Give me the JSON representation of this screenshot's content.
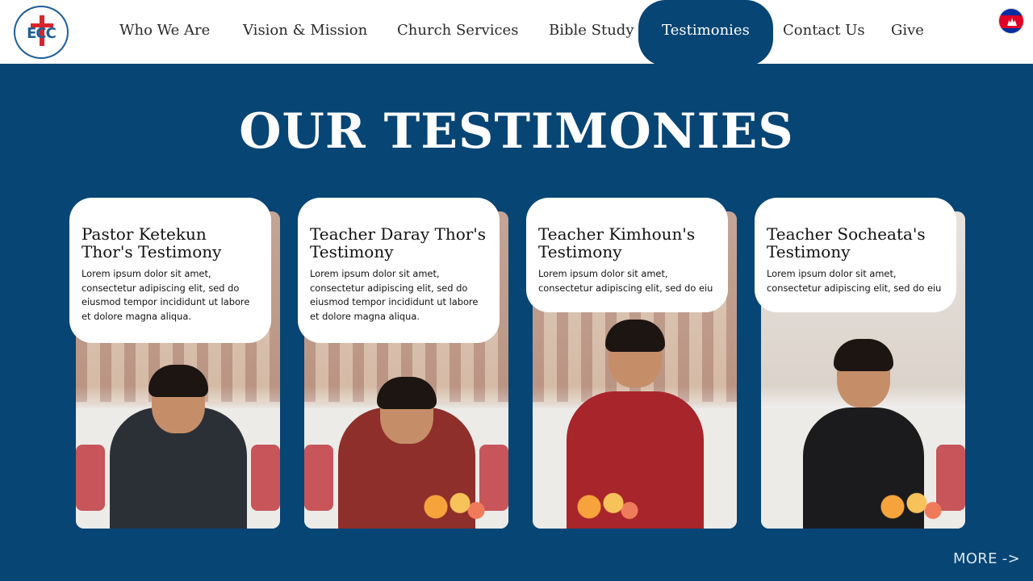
{
  "header": {
    "logo_text": "ECC",
    "nav": [
      {
        "label": "Who We Are"
      },
      {
        "label": "Vision & Mission"
      },
      {
        "label": "Church Services"
      },
      {
        "label": "Bible Study"
      },
      {
        "label": "Testimonies",
        "active": true
      },
      {
        "label": "Contact Us"
      },
      {
        "label": "Give"
      }
    ],
    "language_icon": "cambodia-flag-icon"
  },
  "main": {
    "title": "OUR TESTIMONIES",
    "cards": [
      {
        "title": "Pastor Ketekun Thor's Testimony",
        "text": "Lorem ipsum dolor sit amet, consectetur adipiscing elit, sed do eiusmod tempor incididunt ut labore et dolore magna aliqua."
      },
      {
        "title": "Teacher Daray Thor's Testimony",
        "text": "Lorem ipsum dolor sit amet, consectetur adipiscing elit, sed do eiusmod tempor incididunt ut labore et dolore magna aliqua."
      },
      {
        "title": "Teacher Kimhoun's Testimony",
        "text": "Lorem ipsum dolor sit amet, consectetur adipiscing elit, sed do eiu"
      },
      {
        "title": "Teacher Socheata's Testimony",
        "text": "Lorem ipsum dolor sit amet, consectetur adipiscing elit, sed do eiu"
      }
    ],
    "more_label": "MORE ->"
  },
  "colors": {
    "background": "#074575",
    "header": "#ffffff",
    "active_tab": "#074575"
  }
}
